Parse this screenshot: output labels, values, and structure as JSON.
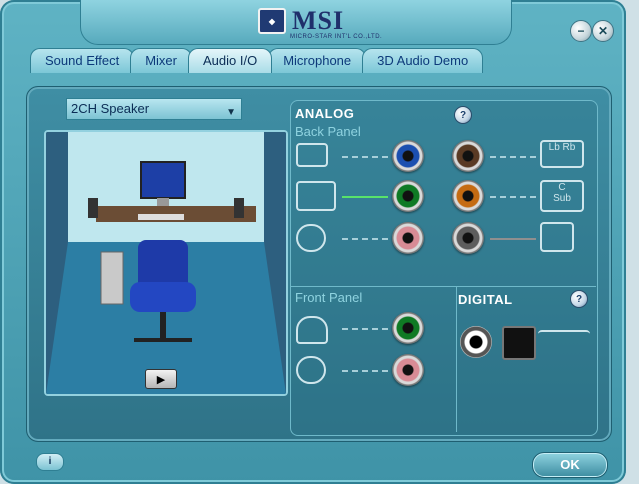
{
  "title": "MSI",
  "logo_subtitle": "MICRO-STAR INT'L CO.,LTD.",
  "window_buttons": [
    "minimize-icon",
    "close-icon"
  ],
  "tabs": [
    {
      "label": "Sound Effect",
      "active": false
    },
    {
      "label": "Mixer",
      "active": false
    },
    {
      "label": "Audio I/O",
      "active": true
    },
    {
      "label": "Microphone",
      "active": false
    },
    {
      "label": "3D Audio Demo",
      "active": false
    }
  ],
  "speaker_select": {
    "value": "2CH Speaker"
  },
  "analog": {
    "title": "ANALOG",
    "back_panel": "Back Panel",
    "front_panel": "Front Panel"
  },
  "digital": {
    "title": "DIGITAL"
  },
  "device_labels": {
    "lb": "Lb",
    "rb": "Rb",
    "c": "C",
    "sub": "Sub"
  },
  "ok_label": "OK",
  "colors": {
    "blue": "#1b4fb0",
    "green": "#0f7a24",
    "pink": "#d88b95",
    "brown": "#5a3a24",
    "orange": "#c56b12",
    "gray": "#5d5d5d",
    "bg": "#3f93a7"
  },
  "icons": [
    "speaker-icon",
    "microphone-icon",
    "headphones-icon",
    "play-icon",
    "info-icon",
    "spdif-optical-icon",
    "spdif-coax-icon",
    "digital-signal-icon"
  ]
}
